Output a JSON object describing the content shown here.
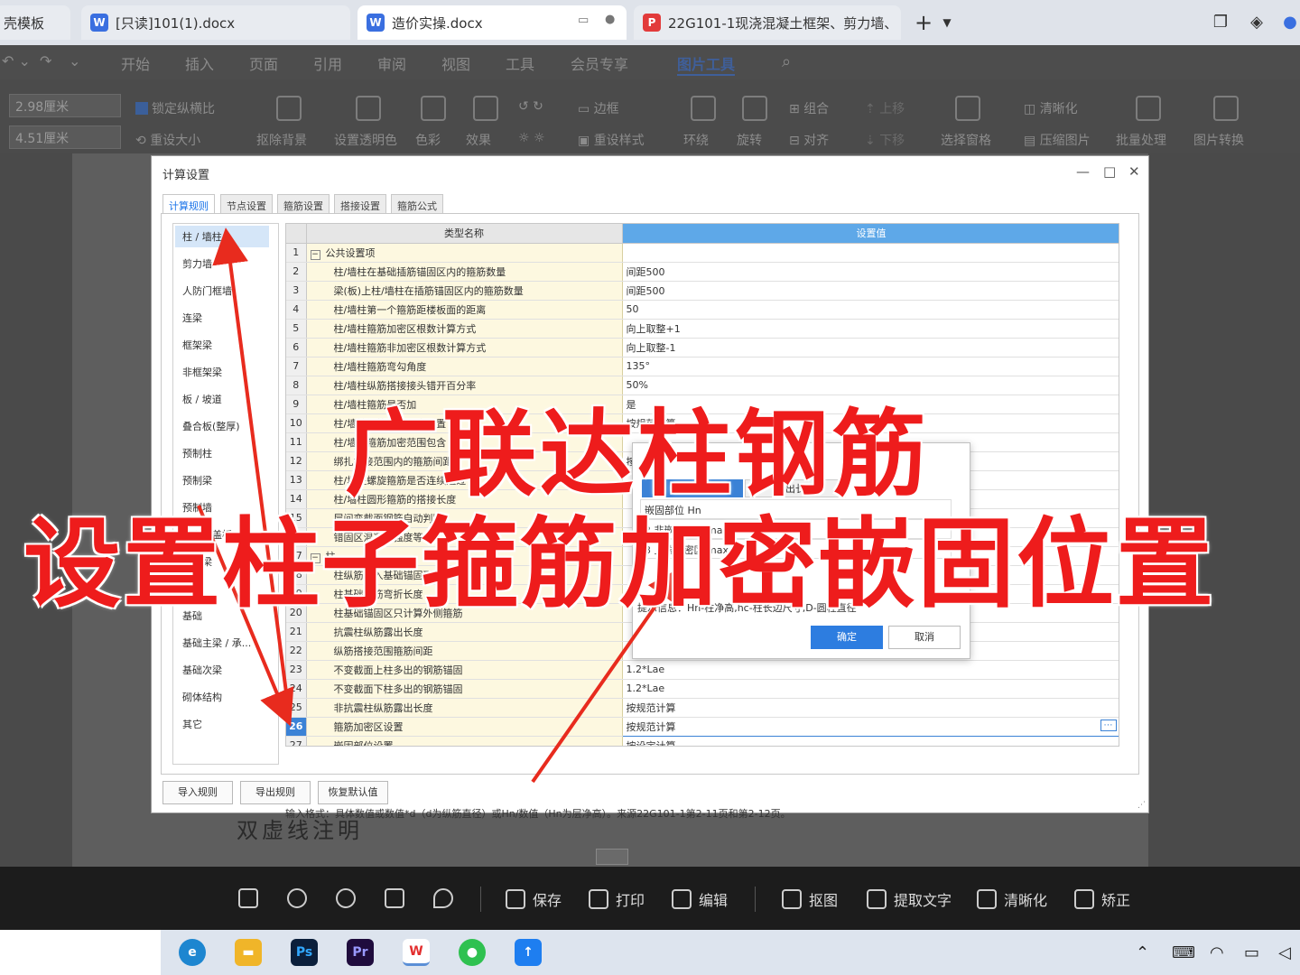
{
  "browser_tabs": [
    {
      "label": "壳模板",
      "icon": ""
    },
    {
      "label": "[只读]101(1).docx",
      "icon": "W"
    },
    {
      "label": "造价实操.docx",
      "icon": "W"
    },
    {
      "label": "22G101-1现浇混凝土框架、剪力墙、",
      "icon": "P"
    }
  ],
  "menu": [
    "开始",
    "插入",
    "页面",
    "引用",
    "审阅",
    "视图",
    "工具",
    "会员专享",
    "图片工具"
  ],
  "ribbon": {
    "width_value": "2.98厘米",
    "height_value": "4.51厘米",
    "lock_ratio": "锁定纵横比",
    "reset_size": "重设大小",
    "remove_bg": "抠除背景",
    "set_transparent": "设置透明色",
    "color": "色彩",
    "effect": "效果",
    "border": "边框",
    "reset_style": "重设样式",
    "wrap": "环绕",
    "rotate": "旋转",
    "group": "组合",
    "align": "对齐",
    "up": "上移",
    "down": "下移",
    "select_pane": "选择窗格",
    "clarify": "清晰化",
    "compress": "压缩图片",
    "batch": "批量处理",
    "convert": "图片转换"
  },
  "doc_text": "双虚线注明",
  "dialog": {
    "title": "计算设置",
    "tabs": [
      "计算规则",
      "节点设置",
      "箍筋设置",
      "搭接设置",
      "箍筋公式"
    ],
    "categories": [
      "柱 / 墙柱",
      "剪力墙",
      "人防门框墙",
      "连梁",
      "框架梁",
      "非框架梁",
      "板 / 坡道",
      "叠合板(整厚)",
      "预制柱",
      "预制梁",
      "预制墙",
      "空心楼盖板",
      "次肋梁",
      "楼梯",
      "基础",
      "基础主梁 / 承...",
      "基础次梁",
      "砌体结构",
      "其它"
    ],
    "columns": {
      "num": "",
      "name": "类型名称",
      "value": "设置值"
    },
    "rows": [
      {
        "no": "1",
        "name": "公共设置项",
        "value": "",
        "group": true
      },
      {
        "no": "2",
        "name": "柱/墙柱在基础插筋锚固区内的箍筋数量",
        "value": "间距500"
      },
      {
        "no": "3",
        "name": "梁(板)上柱/墙柱在插筋锚固区内的箍筋数量",
        "value": "间距500"
      },
      {
        "no": "4",
        "name": "柱/墙柱第一个箍筋距楼板面的距离",
        "value": "50"
      },
      {
        "no": "5",
        "name": "柱/墙柱箍筋加密区根数计算方式",
        "value": "向上取整+1"
      },
      {
        "no": "6",
        "name": "柱/墙柱箍筋非加密区根数计算方式",
        "value": "向上取整-1"
      },
      {
        "no": "7",
        "name": "柱/墙柱箍筋弯勾角度",
        "value": "135°"
      },
      {
        "no": "8",
        "name": "柱/墙柱纵筋搭接接头错开百分率",
        "value": "50%"
      },
      {
        "no": "9",
        "name": "柱/墙柱箍筋是否加",
        "value": "是"
      },
      {
        "no": "10",
        "name": "柱/墙柱纵筋错开距离设置",
        "value": "按规范计算"
      },
      {
        "no": "11",
        "name": "柱/墙柱箍筋加密范围包含",
        "value": ""
      },
      {
        "no": "12",
        "name": "绑扎搭接范围内的箍筋间距",
        "value": "按规范计算"
      },
      {
        "no": "13",
        "name": "柱/墙柱螺旋箍筋是否连续通过",
        "value": ""
      },
      {
        "no": "14",
        "name": "柱/墙柱圆形箍筋的搭接长度",
        "value": ""
      },
      {
        "no": "15",
        "name": "层间变截面钢筋自动判断",
        "value": ""
      },
      {
        "no": "16",
        "name": "错固区混凝土强度等级",
        "value": ""
      },
      {
        "no": "17",
        "name": "柱",
        "value": "",
        "group": true
      },
      {
        "no": "18",
        "name": "柱纵筋伸入基础锚固形式",
        "value": ""
      },
      {
        "no": "19",
        "name": "柱基础插筋弯折长度",
        "value": ""
      },
      {
        "no": "20",
        "name": "柱基础锚固区只计算外侧箍筋",
        "value": ""
      },
      {
        "no": "21",
        "name": "抗震柱纵筋露出长度",
        "value": ""
      },
      {
        "no": "22",
        "name": "纵筋搭接范围箍筋间距",
        "value": ""
      },
      {
        "no": "23",
        "name": "不变截面上柱多出的钢筋锚固",
        "value": "1.2*Lae"
      },
      {
        "no": "24",
        "name": "不变截面下柱多出的钢筋锚固",
        "value": "1.2*Lae"
      },
      {
        "no": "25",
        "name": "非抗震柱纵筋露出长度",
        "value": "按规范计算"
      },
      {
        "no": "26",
        "name": "箍筋加密区设置",
        "value": "按规范计算",
        "selected": true
      },
      {
        "no": "27",
        "name": "嵌固部位设置",
        "value": "按设定计算"
      }
    ],
    "hint": "输入格式：具体数值或数值*d（d为纵筋直径）或Hn/数值（Hn为层净高）。来源22G101-1第2-11页和第2-12页。",
    "buttons": {
      "import": "导入规则",
      "export": "导出规则",
      "restore": "恢复默认值"
    }
  },
  "popup": {
    "tabs": [
      "楼层位置",
      "露出长度"
    ],
    "rows": [
      "嵌固部位 Hn",
      "2 非嵌固部位 max",
      "3 上端加密区 max"
    ],
    "info": "提示信息：Hn-柱净高,hc-柱长边尺寸,D-圆柱直径",
    "ok": "确定",
    "cancel": "取消"
  },
  "viewer_toolbar": {
    "save": "保存",
    "print": "打印",
    "edit": "编辑",
    "matting": "抠图",
    "extract": "提取文字",
    "clarify": "清晰化",
    "correct": "矫正"
  },
  "caption": {
    "line1": "广联达柱钢筋",
    "line2": "设置柱子箍筋加密嵌固位置"
  },
  "colors": {
    "caption": "#ee1c1c",
    "accent": "#3b82d6",
    "header_value": "#5ea8e8"
  }
}
